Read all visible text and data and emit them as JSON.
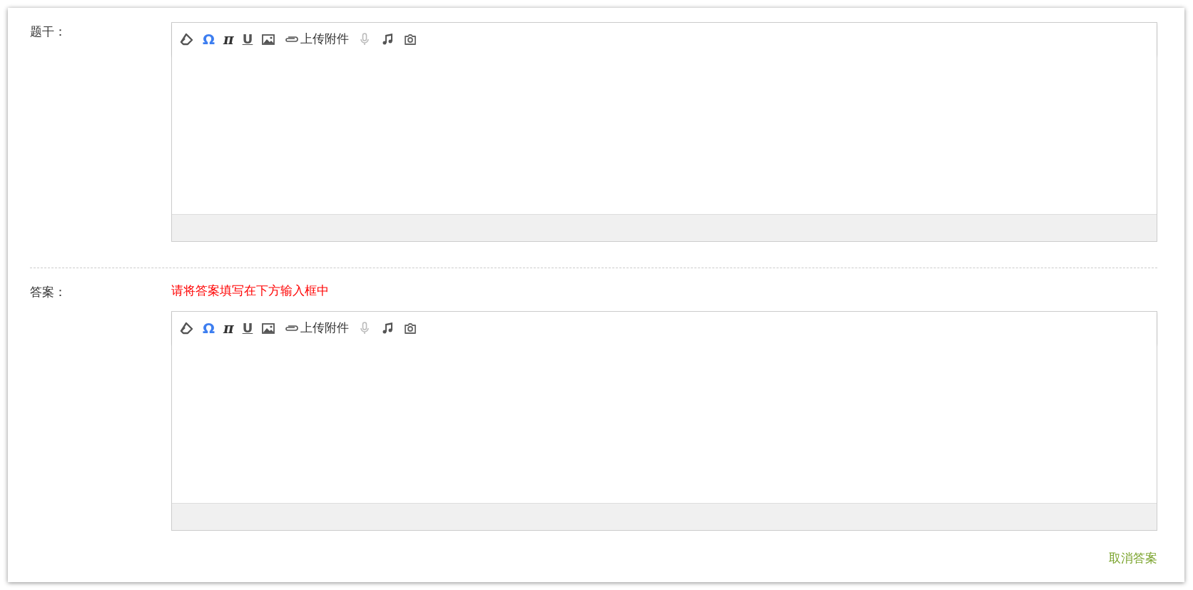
{
  "fields": [
    {
      "label": "题干：",
      "toolbar": [
        {
          "kind": "eraser",
          "disabled": false
        },
        {
          "kind": "special-char",
          "text": "Ω",
          "disabled": false
        },
        {
          "kind": "formula",
          "text": "π",
          "disabled": false
        },
        {
          "kind": "underline",
          "text": "U",
          "disabled": false
        },
        {
          "kind": "image",
          "disabled": false
        },
        {
          "kind": "attachment",
          "text": "上传附件",
          "disabled": false
        },
        {
          "kind": "microphone",
          "disabled": true
        },
        {
          "kind": "music",
          "disabled": false
        },
        {
          "kind": "camera",
          "disabled": false
        }
      ]
    },
    {
      "label": "答案：",
      "hint": "请将答案填写在下方输入框中",
      "toolbar": [
        {
          "kind": "eraser",
          "disabled": false
        },
        {
          "kind": "special-char",
          "text": "Ω",
          "disabled": false
        },
        {
          "kind": "formula",
          "text": "π",
          "disabled": false
        },
        {
          "kind": "underline",
          "text": "U",
          "disabled": false
        },
        {
          "kind": "image",
          "disabled": false
        },
        {
          "kind": "attachment",
          "text": "上传附件",
          "disabled": false
        },
        {
          "kind": "microphone",
          "disabled": true
        },
        {
          "kind": "music",
          "disabled": false
        },
        {
          "kind": "camera",
          "disabled": false
        }
      ]
    }
  ],
  "cancel_link": "取消答案"
}
